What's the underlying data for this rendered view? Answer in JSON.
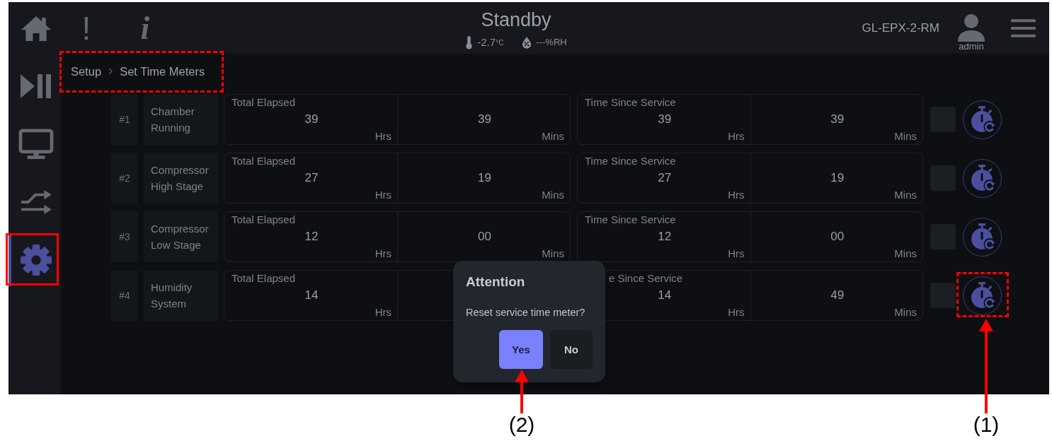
{
  "sidebar": {
    "items": [
      {
        "kind": "home",
        "selected": false
      },
      {
        "kind": "play-pause",
        "selected": false
      },
      {
        "kind": "monitor",
        "selected": false
      },
      {
        "kind": "transfer",
        "selected": false
      },
      {
        "kind": "settings",
        "selected": true
      }
    ]
  },
  "top_bar": {
    "alert_glyph": "!",
    "info_glyph": "i",
    "status": "Standby",
    "temperature": {
      "value": "-2.7",
      "unit": "°C"
    },
    "humidity": "---%RH",
    "device": "GL-EPX-2-RM",
    "user": "admin"
  },
  "breadcrumb": [
    {
      "label": "Setup"
    },
    {
      "label": "Set Time Meters"
    }
  ],
  "meters": [
    {
      "number": "#1",
      "name": "Chamber Running",
      "total_elapsed": {
        "label": "Total Elapsed",
        "hours": "39",
        "hours_unit": "Hrs",
        "minutes": "39",
        "minutes_unit": "Mins"
      },
      "since_service": {
        "label": "Time Since Service",
        "hours": "39",
        "hours_unit": "Hrs",
        "minutes": "39",
        "minutes_unit": "Mins"
      }
    },
    {
      "number": "#2",
      "name": "Compressor High Stage",
      "total_elapsed": {
        "label": "Total Elapsed",
        "hours": "27",
        "hours_unit": "Hrs",
        "minutes": "19",
        "minutes_unit": "Mins"
      },
      "since_service": {
        "label": "Time Since Service",
        "hours": "27",
        "hours_unit": "Hrs",
        "minutes": "19",
        "minutes_unit": "Mins"
      }
    },
    {
      "number": "#3",
      "name": "Compressor Low Stage",
      "total_elapsed": {
        "label": "Total Elapsed",
        "hours": "12",
        "hours_unit": "Hrs",
        "minutes": "00",
        "minutes_unit": "Mins"
      },
      "since_service": {
        "label": "Time Since Service",
        "hours": "12",
        "hours_unit": "Hrs",
        "minutes": "00",
        "minutes_unit": "Mins"
      }
    },
    {
      "number": "#4",
      "name": "Humidity System",
      "total_elapsed": {
        "label": "Total Elapsed",
        "hours": "14",
        "hours_unit": "Hrs"
      },
      "since_service": {
        "label": "e Since Service",
        "hours": "14",
        "hours_unit": "Hrs",
        "minutes": "49",
        "minutes_unit": "Mins"
      }
    }
  ],
  "dialog": {
    "title": "Attention",
    "message": "Reset service time meter?",
    "buttons": [
      {
        "label": "Yes",
        "kind": "primary"
      },
      {
        "label": "No",
        "kind": "secondary"
      }
    ]
  },
  "annotations": [
    {
      "label": "(2)"
    },
    {
      "label": "(1)"
    }
  ]
}
